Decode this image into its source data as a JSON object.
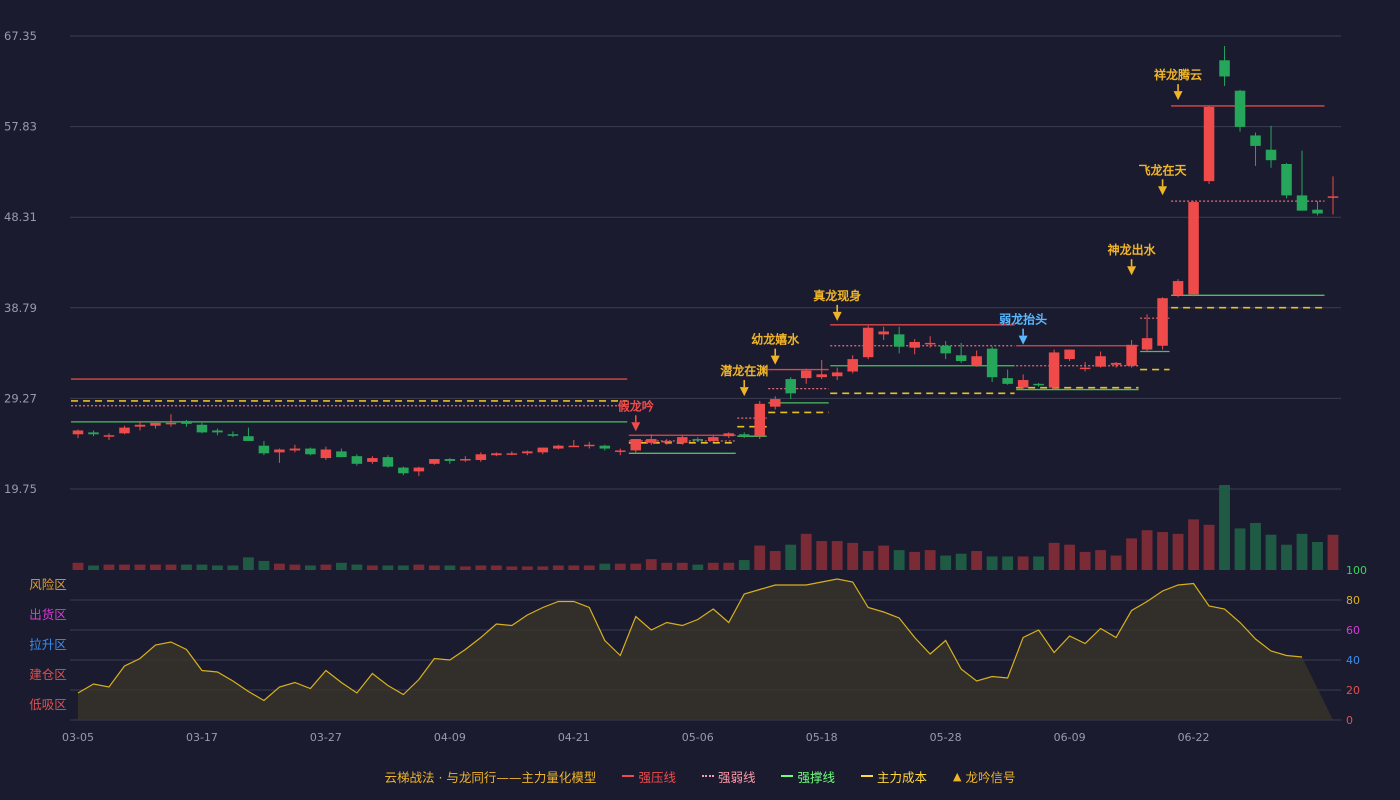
{
  "chart_data": {
    "type": "candlestick",
    "price_axis": {
      "ticks": [
        "67.35",
        "57.83",
        "48.31",
        "38.79",
        "29.27",
        "19.75"
      ],
      "ylim": [
        19.75,
        67.35
      ]
    },
    "oscillator_axis": {
      "ticks": [
        {
          "value": 100,
          "label": "100",
          "color": "#37d45a"
        },
        {
          "value": 80,
          "label": "80",
          "color": "#e0b020"
        },
        {
          "value": 60,
          "label": "60",
          "color": "#d83ad8"
        },
        {
          "value": 40,
          "label": "40",
          "color": "#3a8df0"
        },
        {
          "value": 20,
          "label": "20",
          "color": "#e05050"
        },
        {
          "value": 0,
          "label": "0",
          "color": "#e05050"
        }
      ],
      "zones": [
        {
          "label": "风险区",
          "color": "#e0a030"
        },
        {
          "label": "出货区",
          "color": "#d83ad8"
        },
        {
          "label": "拉升区",
          "color": "#3a8df0"
        },
        {
          "label": "建仓区",
          "color": "#e05050"
        },
        {
          "label": "低吸区",
          "color": "#e05050"
        }
      ]
    },
    "x_ticks": [
      {
        "index": 0,
        "label": "03-05"
      },
      {
        "index": 8,
        "label": "03-17"
      },
      {
        "index": 16,
        "label": "03-27"
      },
      {
        "index": 24,
        "label": "04-09"
      },
      {
        "index": 32,
        "label": "04-21"
      },
      {
        "index": 40,
        "label": "05-06"
      },
      {
        "index": 48,
        "label": "05-18"
      },
      {
        "index": 56,
        "label": "05-28"
      },
      {
        "index": 64,
        "label": "06-09"
      },
      {
        "index": 72,
        "label": "06-22"
      }
    ],
    "candles": [
      [
        25.5,
        26.0,
        25.1,
        25.9,
        0.8
      ],
      [
        25.7,
        25.9,
        25.3,
        25.5,
        0.5
      ],
      [
        25.3,
        25.6,
        24.9,
        25.4,
        0.6
      ],
      [
        25.6,
        26.4,
        25.5,
        26.2,
        0.6
      ],
      [
        26.3,
        26.9,
        25.9,
        26.5,
        0.6
      ],
      [
        26.4,
        26.8,
        26.1,
        26.7,
        0.6
      ],
      [
        26.6,
        27.6,
        26.3,
        26.7,
        0.6
      ],
      [
        26.9,
        27.0,
        26.3,
        26.6,
        0.6
      ],
      [
        26.5,
        26.7,
        25.6,
        25.7,
        0.6
      ],
      [
        25.9,
        26.1,
        25.4,
        25.7,
        0.5
      ],
      [
        25.5,
        25.8,
        25.2,
        25.4,
        0.5
      ],
      [
        25.3,
        26.2,
        24.8,
        24.8,
        1.4
      ],
      [
        24.3,
        24.8,
        23.3,
        23.5,
        1.0
      ],
      [
        23.6,
        24.0,
        22.5,
        23.9,
        0.7
      ],
      [
        23.8,
        24.4,
        23.6,
        24.0,
        0.6
      ],
      [
        24.0,
        24.1,
        23.3,
        23.4,
        0.5
      ],
      [
        23.0,
        24.2,
        22.8,
        23.9,
        0.6
      ],
      [
        23.7,
        24.0,
        23.1,
        23.1,
        0.8
      ],
      [
        23.2,
        23.4,
        22.2,
        22.4,
        0.6
      ],
      [
        22.6,
        23.2,
        22.4,
        23.0,
        0.5
      ],
      [
        23.1,
        23.3,
        22.0,
        22.1,
        0.5
      ],
      [
        22.0,
        22.1,
        21.2,
        21.4,
        0.5
      ],
      [
        21.6,
        22.1,
        21.1,
        22.0,
        0.6
      ],
      [
        22.4,
        22.9,
        22.3,
        22.9,
        0.5
      ],
      [
        22.9,
        23.0,
        22.4,
        22.7,
        0.5
      ],
      [
        22.8,
        23.2,
        22.6,
        22.9,
        0.4
      ],
      [
        22.8,
        23.6,
        22.6,
        23.4,
        0.5
      ],
      [
        23.3,
        23.6,
        23.2,
        23.5,
        0.5
      ],
      [
        23.5,
        23.7,
        23.3,
        23.5,
        0.4
      ],
      [
        23.5,
        23.8,
        23.3,
        23.7,
        0.4
      ],
      [
        23.6,
        24.1,
        23.4,
        24.1,
        0.4
      ],
      [
        24.0,
        24.4,
        23.9,
        24.3,
        0.5
      ],
      [
        24.3,
        24.9,
        24.2,
        24.3,
        0.5
      ],
      [
        24.3,
        24.7,
        24.0,
        24.4,
        0.5
      ],
      [
        24.3,
        24.4,
        23.8,
        24.0,
        0.7
      ],
      [
        23.7,
        24.0,
        23.3,
        23.8,
        0.7
      ],
      [
        23.8,
        25.0,
        23.5,
        25.0,
        0.7
      ],
      [
        24.6,
        25.5,
        24.4,
        25.0,
        1.2
      ],
      [
        24.7,
        25.0,
        24.4,
        24.8,
        0.8
      ],
      [
        24.6,
        25.4,
        24.4,
        25.2,
        0.8
      ],
      [
        25.0,
        25.2,
        24.7,
        24.9,
        0.6
      ],
      [
        24.8,
        25.4,
        24.7,
        25.2,
        0.8
      ],
      [
        25.3,
        25.7,
        25.1,
        25.6,
        0.8
      ],
      [
        25.5,
        25.7,
        25.1,
        25.3,
        1.1
      ],
      [
        25.3,
        29.0,
        25.0,
        28.7,
        2.7
      ],
      [
        28.4,
        29.5,
        28.1,
        29.2,
        2.1
      ],
      [
        31.3,
        31.5,
        29.2,
        29.8,
        2.8
      ],
      [
        31.4,
        32.4,
        30.8,
        32.2,
        4.0
      ],
      [
        31.5,
        33.3,
        31.3,
        31.8,
        3.2
      ],
      [
        31.6,
        32.5,
        31.2,
        32.0,
        3.2
      ],
      [
        32.1,
        33.8,
        31.9,
        33.4,
        3.0
      ],
      [
        33.6,
        36.9,
        33.4,
        36.7,
        2.1
      ],
      [
        36.0,
        36.8,
        35.4,
        36.3,
        2.7
      ],
      [
        36.0,
        36.8,
        34.0,
        34.7,
        2.2
      ],
      [
        34.6,
        35.5,
        33.9,
        35.2,
        2.0
      ],
      [
        35.1,
        35.8,
        34.6,
        35.1,
        2.2
      ],
      [
        34.8,
        35.3,
        33.4,
        34.0,
        1.6
      ],
      [
        33.8,
        35.1,
        33.0,
        33.2,
        1.8
      ],
      [
        32.7,
        34.3,
        32.6,
        33.7,
        2.1
      ],
      [
        34.5,
        34.7,
        31.0,
        31.5,
        1.5
      ],
      [
        31.4,
        32.3,
        30.7,
        30.8,
        1.5
      ],
      [
        30.4,
        31.8,
        30.2,
        31.2,
        1.5
      ],
      [
        30.8,
        30.9,
        30.5,
        30.7,
        1.5
      ],
      [
        30.4,
        34.4,
        30.2,
        34.1,
        3.0
      ],
      [
        33.4,
        34.4,
        33.2,
        34.4,
        2.8
      ],
      [
        32.5,
        33.1,
        32.1,
        32.5,
        2.0
      ],
      [
        32.6,
        34.2,
        32.5,
        33.7,
        2.2
      ],
      [
        32.8,
        33.1,
        32.5,
        33.0,
        1.6
      ],
      [
        32.7,
        35.4,
        32.5,
        34.9,
        3.5
      ],
      [
        34.4,
        38.1,
        34.2,
        35.6,
        4.4
      ],
      [
        34.8,
        39.9,
        34.4,
        39.8,
        4.2
      ],
      [
        40.1,
        41.8,
        39.9,
        41.6,
        4.0
      ],
      [
        40.2,
        50.0,
        40.0,
        49.9,
        5.6
      ],
      [
        52.1,
        60.0,
        51.8,
        59.9,
        5.0
      ],
      [
        64.8,
        66.3,
        62.1,
        63.1,
        9.4
      ],
      [
        61.6,
        61.7,
        57.3,
        57.8,
        4.6
      ],
      [
        56.9,
        57.2,
        53.7,
        55.8,
        5.2
      ],
      [
        55.4,
        57.9,
        53.5,
        54.3,
        3.9
      ],
      [
        53.9,
        54.0,
        50.3,
        50.6,
        2.8
      ],
      [
        50.6,
        55.3,
        49.0,
        49.0,
        4.0
      ],
      [
        49.1,
        50.0,
        48.5,
        48.7,
        3.1
      ],
      [
        50.5,
        52.6,
        48.6,
        50.5,
        3.9
      ]
    ],
    "oscillator": [
      18,
      24,
      22,
      36,
      41,
      50,
      52,
      47,
      33,
      32,
      26,
      19,
      13,
      22,
      25,
      21,
      33,
      25,
      18,
      31,
      23,
      17,
      27,
      41,
      40,
      47,
      55,
      64,
      63,
      70,
      75,
      79,
      79,
      75,
      53,
      43,
      69,
      60,
      65,
      63,
      67,
      74,
      65,
      84,
      87,
      90,
      90,
      90,
      92,
      94,
      92,
      75,
      72,
      68,
      55,
      44,
      53,
      34,
      26,
      29,
      28,
      55,
      60,
      45,
      56,
      51,
      61,
      55,
      73,
      79,
      86,
      90,
      91,
      76,
      74,
      65,
      54,
      46,
      43,
      42
    ],
    "levels": [
      {
        "kind": "resist",
        "price": 31.3,
        "from": 0,
        "to": 35
      },
      {
        "kind": "weak",
        "price": 28.5,
        "from": 0,
        "to": 35
      },
      {
        "kind": "cost",
        "price": 29.0,
        "from": 0,
        "to": 35
      },
      {
        "kind": "support",
        "price": 26.8,
        "from": 0,
        "to": 35
      },
      {
        "kind": "resist",
        "price": 25.4,
        "from": 36,
        "to": 42
      },
      {
        "kind": "weak",
        "price": 24.8,
        "from": 36,
        "to": 42
      },
      {
        "kind": "cost",
        "price": 24.6,
        "from": 36,
        "to": 42
      },
      {
        "kind": "support",
        "price": 23.5,
        "from": 36,
        "to": 42
      },
      {
        "kind": "weak",
        "price": 27.2,
        "from": 43,
        "to": 44
      },
      {
        "kind": "cost",
        "price": 26.3,
        "from": 43,
        "to": 44
      },
      {
        "kind": "support",
        "price": 25.3,
        "from": 43,
        "to": 44
      },
      {
        "kind": "resist",
        "price": 32.3,
        "from": 45,
        "to": 48
      },
      {
        "kind": "weak",
        "price": 30.3,
        "from": 45,
        "to": 48
      },
      {
        "kind": "support",
        "price": 28.8,
        "from": 45,
        "to": 48
      },
      {
        "kind": "cost",
        "price": 27.8,
        "from": 45,
        "to": 48
      },
      {
        "kind": "resist",
        "price": 37.0,
        "from": 49,
        "to": 60
      },
      {
        "kind": "weak",
        "price": 34.8,
        "from": 49,
        "to": 60
      },
      {
        "kind": "support",
        "price": 32.7,
        "from": 49,
        "to": 60
      },
      {
        "kind": "cost",
        "price": 29.8,
        "from": 49,
        "to": 60
      },
      {
        "kind": "resist",
        "price": 34.8,
        "from": 61,
        "to": 68
      },
      {
        "kind": "weak",
        "price": 32.7,
        "from": 61,
        "to": 68
      },
      {
        "kind": "cost",
        "price": 30.4,
        "from": 61,
        "to": 68
      },
      {
        "kind": "support",
        "price": 30.2,
        "from": 61,
        "to": 68
      },
      {
        "kind": "weak",
        "price": 37.7,
        "from": 69,
        "to": 70
      },
      {
        "kind": "support",
        "price": 34.2,
        "from": 69,
        "to": 70
      },
      {
        "kind": "cost",
        "price": 32.3,
        "from": 69,
        "to": 70
      },
      {
        "kind": "resist",
        "price": 60.0,
        "from": 71,
        "to": 80
      },
      {
        "kind": "weak",
        "price": 50.0,
        "from": 71,
        "to": 80
      },
      {
        "kind": "support",
        "price": 40.1,
        "from": 71,
        "to": 80
      },
      {
        "kind": "cost",
        "price": 38.8,
        "from": 71,
        "to": 80
      }
    ],
    "signals": [
      {
        "label": "假龙吟",
        "index": 36,
        "price": 25.5,
        "color": "#ef4b4b"
      },
      {
        "label": "潜龙在渊",
        "index": 43,
        "price": 29.2,
        "color": "#f0b429"
      },
      {
        "label": "幼龙嬉水",
        "index": 45,
        "price": 32.5,
        "color": "#f0b429"
      },
      {
        "label": "真龙现身",
        "index": 49,
        "price": 37.1,
        "color": "#f0b429"
      },
      {
        "label": "弱龙抬头",
        "index": 61,
        "price": 34.6,
        "color": "#59b8ff"
      },
      {
        "label": "神龙出水",
        "index": 68,
        "price": 41.9,
        "color": "#f0b429"
      },
      {
        "label": "飞龙在天",
        "index": 70,
        "price": 50.3,
        "color": "#f0b429"
      },
      {
        "label": "祥龙腾云",
        "index": 71,
        "price": 60.3,
        "color": "#f0b429"
      }
    ],
    "colors": {
      "background": "#1a1b2e",
      "grid": "#3a3c50",
      "tick": "#9a9aae",
      "up": "#ef4b4b",
      "down": "#26a65b",
      "vol_up": "#7a2b35",
      "vol_down": "#1f5a44",
      "resist": "#e04848",
      "weak": "#e86a7a",
      "support": "#4ac060",
      "cost": "#e8c020",
      "osc_line": "#d8b01e"
    },
    "legend": [
      {
        "label": "云梯战法 · 与龙同行——主力量化模型",
        "color": "#f0b429",
        "swatch": "none"
      },
      {
        "label": "强压线",
        "color": "#ef4b4b",
        "swatch": "solid"
      },
      {
        "label": "强弱线",
        "color": "#ff9aa8",
        "swatch": "dotted"
      },
      {
        "label": "强撑线",
        "color": "#6dff7a",
        "swatch": "solid"
      },
      {
        "label": "主力成本",
        "color": "#ffd83a",
        "swatch": "dashed"
      },
      {
        "label": "龙吟信号",
        "color": "#f0b429",
        "swatch": "triangle"
      }
    ]
  }
}
